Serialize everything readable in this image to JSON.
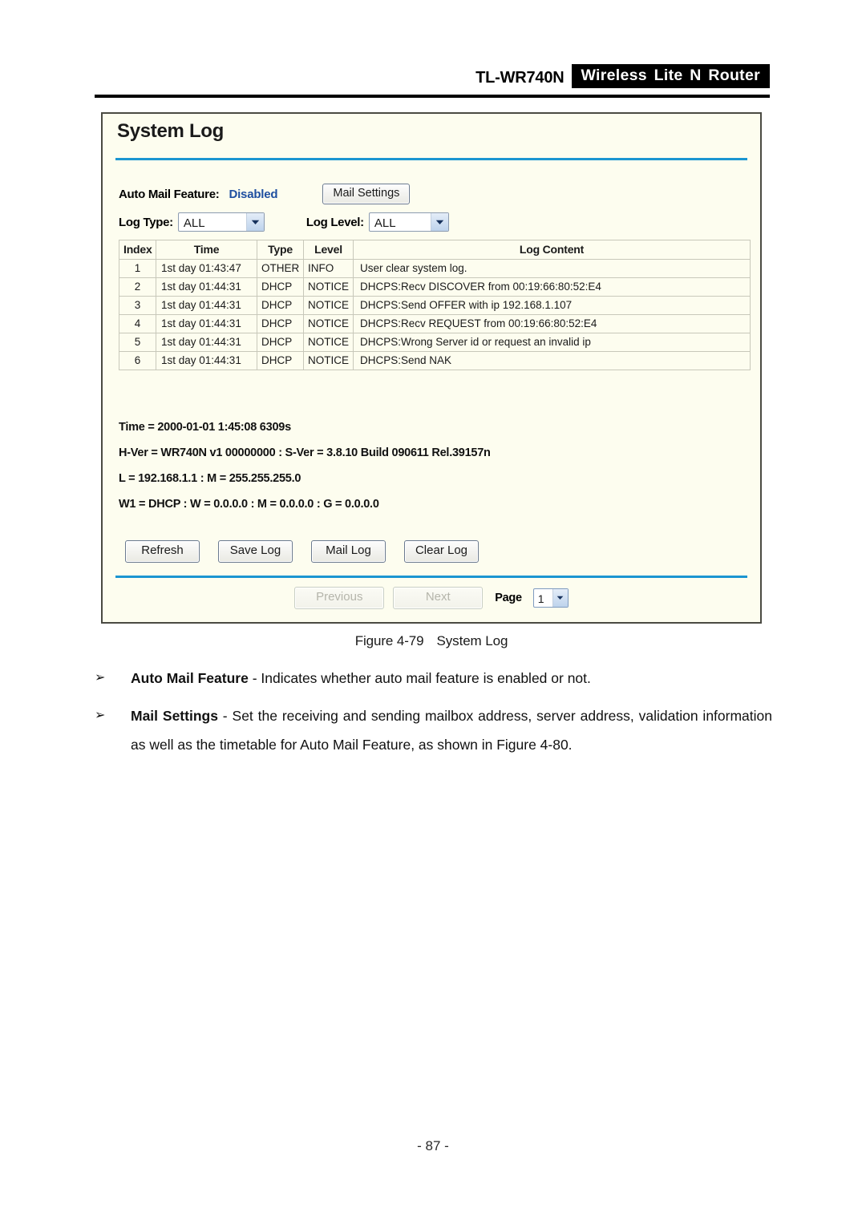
{
  "document": {
    "header": {
      "model": "TL-WR740N",
      "product": "Wireless Lite N Router"
    },
    "figure_caption_number": "Figure 4-79",
    "figure_caption_title": "System Log",
    "page_number": "- 87 -",
    "bullets": [
      {
        "glyph": "➢",
        "term": "Auto Mail Feature",
        "separator": " - ",
        "text": "Indicates whether auto mail feature is enabled or not."
      },
      {
        "glyph": "➢",
        "term": "Mail Settings",
        "separator": " - ",
        "text": "Set the receiving and sending mailbox address, server address, validation information as well as the timetable for Auto Mail Feature, as shown in Figure 4-80."
      }
    ]
  },
  "panel": {
    "title": "System Log",
    "auto_mail": {
      "label": "Auto Mail Feature:",
      "value": "Disabled",
      "value_color": "#1f4fa0",
      "button_label": "Mail Settings"
    },
    "filters": {
      "log_type_label": "Log Type:",
      "log_type_value": "ALL",
      "log_level_label": "Log Level:",
      "log_level_value": "ALL"
    },
    "table": {
      "headers": [
        "Index",
        "Time",
        "Type",
        "Level",
        "Log Content"
      ],
      "rows": [
        {
          "index": "1",
          "time": "1st day 01:43:47",
          "type": "OTHER",
          "level": "INFO",
          "content": "User clear system log."
        },
        {
          "index": "2",
          "time": "1st day 01:44:31",
          "type": "DHCP",
          "level": "NOTICE",
          "content": "DHCPS:Recv DISCOVER from 00:19:66:80:52:E4"
        },
        {
          "index": "3",
          "time": "1st day 01:44:31",
          "type": "DHCP",
          "level": "NOTICE",
          "content": "DHCPS:Send OFFER with ip 192.168.1.107"
        },
        {
          "index": "4",
          "time": "1st day 01:44:31",
          "type": "DHCP",
          "level": "NOTICE",
          "content": "DHCPS:Recv REQUEST from 00:19:66:80:52:E4"
        },
        {
          "index": "5",
          "time": "1st day 01:44:31",
          "type": "DHCP",
          "level": "NOTICE",
          "content": "DHCPS:Wrong Server id or request an invalid ip"
        },
        {
          "index": "6",
          "time": "1st day 01:44:31",
          "type": "DHCP",
          "level": "NOTICE",
          "content": "DHCPS:Send NAK"
        }
      ]
    },
    "system_info": [
      "Time = 2000-01-01 1:45:08 6309s",
      "H-Ver = WR740N v1 00000000 : S-Ver = 3.8.10 Build 090611 Rel.39157n",
      "L = 192.168.1.1 : M = 255.255.255.0",
      "W1 = DHCP : W = 0.0.0.0 : M = 0.0.0.0 : G = 0.0.0.0"
    ],
    "actions": {
      "refresh": "Refresh",
      "save_log": "Save Log",
      "mail_log": "Mail Log",
      "clear_log": "Clear Log"
    },
    "pager": {
      "previous": "Previous",
      "next": "Next",
      "page_label": "Page",
      "page_value": "1"
    },
    "colors": {
      "panel_background": "#fdfdef",
      "panel_border": "#4a4a42",
      "accent_rule": "#1b95d1",
      "link_blue": "#1f4fa0"
    }
  }
}
